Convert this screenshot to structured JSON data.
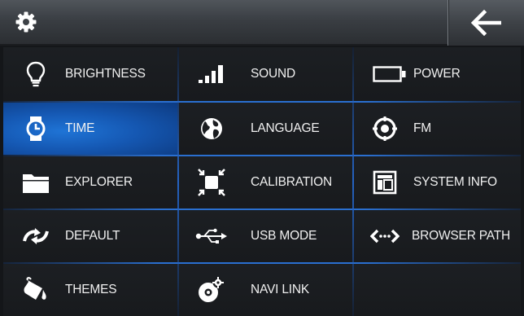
{
  "header": {
    "settings_icon": "gear-icon",
    "back_icon": "arrow-left-icon"
  },
  "menu": [
    {
      "label": "BRIGHTNESS",
      "icon": "lightbulb-icon"
    },
    {
      "label": "SOUND",
      "icon": "signal-bars-icon"
    },
    {
      "label": "POWER",
      "icon": "battery-icon"
    },
    {
      "label": "TIME",
      "icon": "watch-icon",
      "selected": true
    },
    {
      "label": "LANGUAGE",
      "icon": "globe-icon"
    },
    {
      "label": "FM",
      "icon": "radio-target-icon"
    },
    {
      "label": "EXPLORER",
      "icon": "folder-icon"
    },
    {
      "label": "CALIBRATION",
      "icon": "calibration-icon"
    },
    {
      "label": "SYSTEM INFO",
      "icon": "system-info-icon"
    },
    {
      "label": "DEFAULT",
      "icon": "reset-arrows-icon"
    },
    {
      "label": "USB MODE",
      "icon": "usb-icon"
    },
    {
      "label": "BROWSER PATH",
      "icon": "browser-path-icon"
    },
    {
      "label": "THEMES",
      "icon": "paint-bucket-icon"
    },
    {
      "label": "NAVI LINK",
      "icon": "navi-disc-icon"
    }
  ],
  "colors": {
    "selected": "#1a66c9",
    "divider": "#2a6fd0",
    "background": "#181a1d",
    "text": "#f0f0f0"
  }
}
